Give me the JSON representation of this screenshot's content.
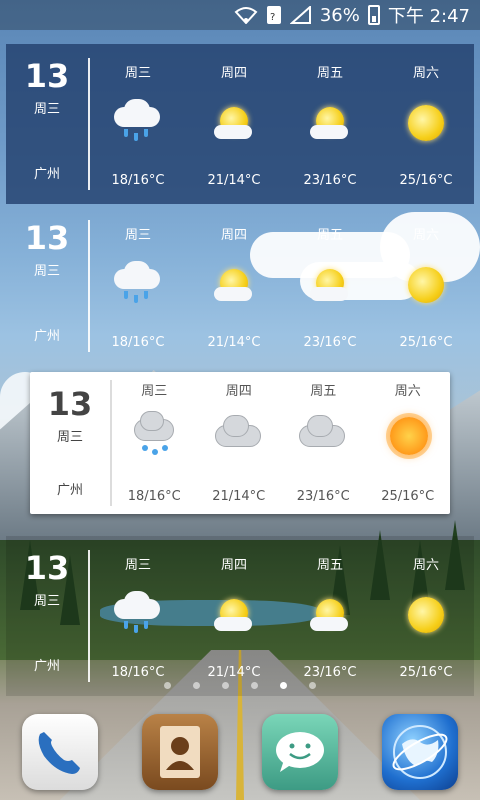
{
  "status_bar": {
    "battery": "36%",
    "time": "下午 2:47"
  },
  "widgets": [
    {
      "day": "13",
      "weekday": "周三",
      "city": "广州",
      "forecast": [
        {
          "name": "周三",
          "temp": "18/16°C",
          "icon": "rain-cloud-icon"
        },
        {
          "name": "周四",
          "temp": "21/14°C",
          "icon": "sun-cloud-icon"
        },
        {
          "name": "周五",
          "temp": "23/16°C",
          "icon": "sun-cloud-icon"
        },
        {
          "name": "周六",
          "temp": "25/16°C",
          "icon": "sun-icon"
        }
      ]
    },
    {
      "day": "13",
      "weekday": "周三",
      "city": "广州",
      "forecast": [
        {
          "name": "周三",
          "temp": "18/16°C",
          "icon": "rain-cloud-icon"
        },
        {
          "name": "周四",
          "temp": "21/14°C",
          "icon": "sun-cloud-icon"
        },
        {
          "name": "周五",
          "temp": "23/16°C",
          "icon": "sun-cloud-icon"
        },
        {
          "name": "周六",
          "temp": "25/16°C",
          "icon": "sun-icon"
        }
      ]
    },
    {
      "day": "13",
      "weekday": "周三",
      "city": "广州",
      "forecast": [
        {
          "name": "周三",
          "temp": "18/16°C",
          "icon": "rain-cloud-icon"
        },
        {
          "name": "周四",
          "temp": "21/14°C",
          "icon": "cloud-icon"
        },
        {
          "name": "周五",
          "temp": "23/16°C",
          "icon": "cloud-icon"
        },
        {
          "name": "周六",
          "temp": "25/16°C",
          "icon": "sun-icon"
        }
      ]
    },
    {
      "day": "13",
      "weekday": "周三",
      "city": "广州",
      "forecast": [
        {
          "name": "周三",
          "temp": "18/16°C",
          "icon": "rain-cloud-icon"
        },
        {
          "name": "周四",
          "temp": "21/14°C",
          "icon": "sun-cloud-icon"
        },
        {
          "name": "周五",
          "temp": "23/16°C",
          "icon": "sun-cloud-icon"
        },
        {
          "name": "周六",
          "temp": "25/16°C",
          "icon": "sun-icon"
        }
      ]
    }
  ],
  "page_indicator": {
    "pages": 6,
    "active": 5
  },
  "dock": [
    {
      "name": "phone-app-icon"
    },
    {
      "name": "contacts-app-icon"
    },
    {
      "name": "messaging-app-icon"
    },
    {
      "name": "browser-app-icon"
    }
  ]
}
